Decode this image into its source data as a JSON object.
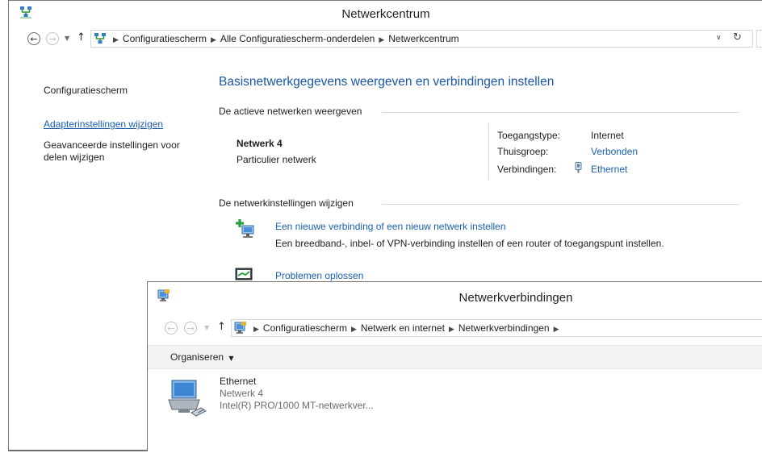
{
  "main_window": {
    "title": "Netwerkcentrum",
    "address": {
      "crumbs": [
        "Configuratiescherm",
        "Alle Configuratiescherm-onderdelen",
        "Netwerkcentrum"
      ]
    },
    "left_nav": {
      "home": "Configuratiescherm",
      "items": [
        "Adapterinstellingen wijzigen",
        "Geavanceerde instellingen voor delen wijzigen"
      ]
    },
    "heading": "Basisnetwerkgegevens weergeven en verbindingen instellen",
    "active_section_label": "De actieve netwerken weergeven",
    "network": {
      "name": "Netwerk 4",
      "type": "Particulier netwerk",
      "props": [
        {
          "label": "Toegangstype:",
          "value": "Internet"
        },
        {
          "label": "Thuisgroep:",
          "value": "Verbonden"
        },
        {
          "label": "Verbindingen:",
          "value": "Ethernet"
        }
      ]
    },
    "change_section_label": "De netwerkinstellingen wijzigen",
    "tasks": [
      {
        "title": "Een nieuwe verbinding of een nieuw netwerk instellen",
        "desc": "Een breedband-, inbel- of VPN-verbinding instellen of een router of toegangspunt instellen."
      },
      {
        "title": "Problemen oplossen",
        "desc": ""
      }
    ]
  },
  "second_window": {
    "title": "Netwerkverbindingen",
    "address": {
      "crumbs": [
        "Configuratiescherm",
        "Netwerk en internet",
        "Netwerkverbindingen"
      ]
    },
    "organize_label": "Organiseren",
    "adapter": {
      "name": "Ethernet",
      "network": "Netwerk 4",
      "device": "Intel(R) PRO/1000 MT-netwerkver..."
    }
  }
}
